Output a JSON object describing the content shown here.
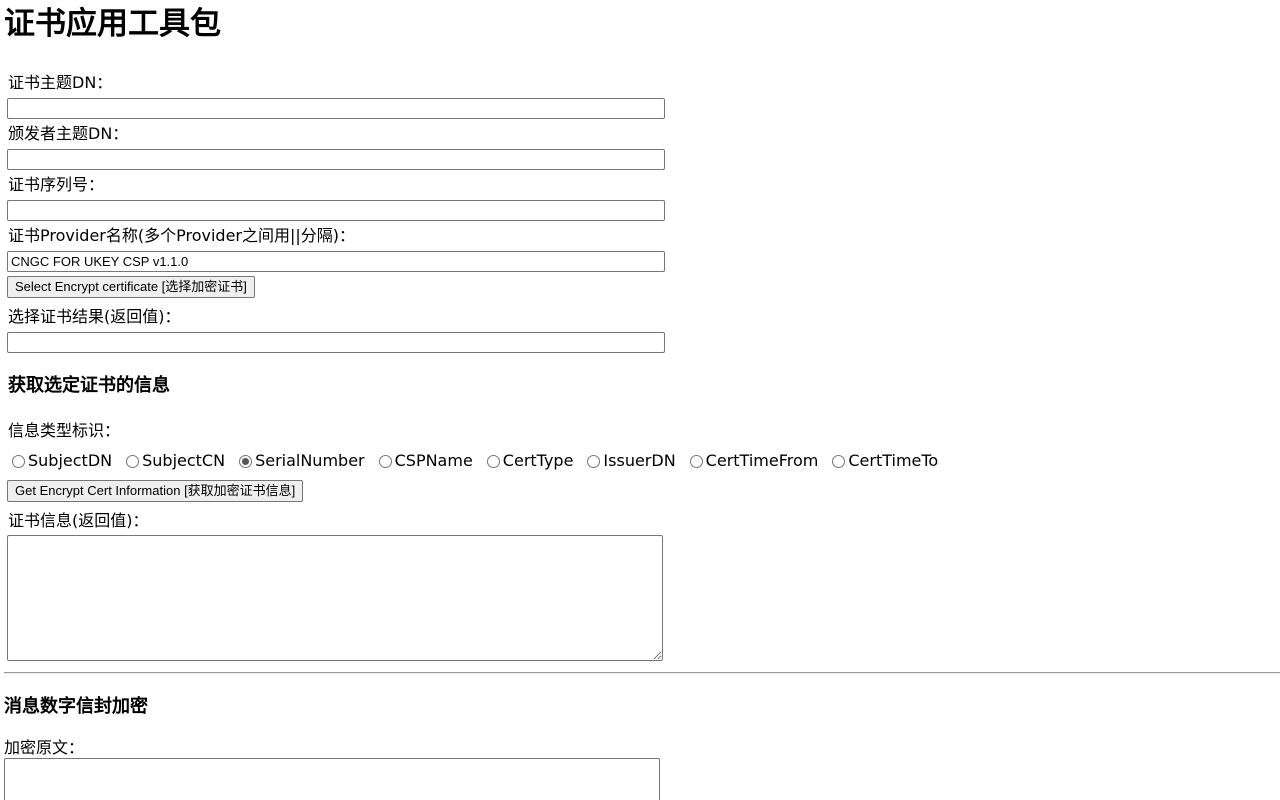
{
  "page": {
    "title": "证书应用工具包"
  },
  "cert_select": {
    "subject_dn_label": "证书主题DN：",
    "subject_dn_value": "",
    "issuer_dn_label": "颁发者主题DN：",
    "issuer_dn_value": "",
    "serial_label": "证书序列号：",
    "serial_value": "",
    "provider_label": "证书Provider名称(多个Provider之间用||分隔)：",
    "provider_value": "CNGC FOR UKEY CSP v1.1.0",
    "select_button": "Select Encrypt certificate [选择加密证书]",
    "result_label": "选择证书结果(返回值)：",
    "result_value": ""
  },
  "cert_info": {
    "heading": "获取选定证书的信息",
    "type_label": "信息类型标识：",
    "types": [
      {
        "label": "SubjectDN",
        "checked": false
      },
      {
        "label": "SubjectCN",
        "checked": false
      },
      {
        "label": "SerialNumber",
        "checked": true
      },
      {
        "label": "CSPName",
        "checked": false
      },
      {
        "label": "CertType",
        "checked": false
      },
      {
        "label": "IssuerDN",
        "checked": false
      },
      {
        "label": "CertTimeFrom",
        "checked": false
      },
      {
        "label": "CertTimeTo",
        "checked": false
      }
    ],
    "get_button": "Get Encrypt Cert Information [获取加密证书信息]",
    "result_label": "证书信息(返回值)：",
    "result_value": ""
  },
  "envelope": {
    "heading": "消息数字信封加密",
    "plaintext_label": "加密原文：",
    "plaintext_value": ""
  }
}
